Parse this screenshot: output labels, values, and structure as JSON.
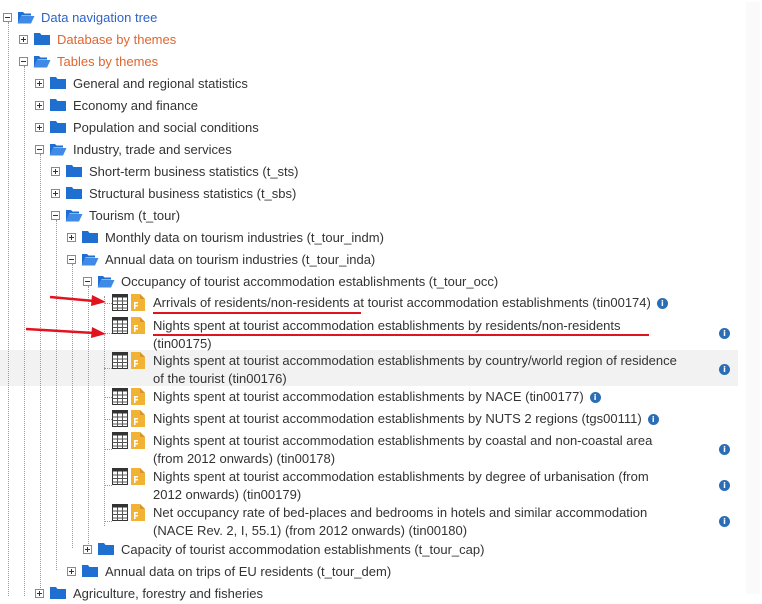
{
  "tree": {
    "root": "Data navigation tree",
    "database_by_themes": "Database by themes",
    "tables_by_themes": "Tables by themes",
    "general": "General and regional statistics",
    "economy": "Economy and finance",
    "population": "Population and social conditions",
    "industry": "Industry, trade and services",
    "short_term": "Short-term business statistics (t_sts)",
    "structural": "Structural business statistics (t_sbs)",
    "tourism": "Tourism (t_tour)",
    "monthly": "Monthly data on tourism industries (t_tour_indm)",
    "annual_industries": "Annual data on tourism industries (t_tour_inda)",
    "occupancy": "Occupancy of tourist accommodation establishments (t_tour_occ)",
    "datasets": [
      {
        "line1": "Arrivals of residents/non-residents at tourist accommodation establishments (tin00174)",
        "line2": ""
      },
      {
        "line1": "Nights spent at tourist accommodation establishments by residents/non-residents",
        "line2": "(tin00175)"
      },
      {
        "line1": "Nights spent at tourist accommodation establishments by country/world region of residence",
        "line2": "of the tourist (tin00176)"
      },
      {
        "line1": "Nights spent at tourist accommodation establishments by NACE (tin00177)",
        "line2": ""
      },
      {
        "line1": "Nights spent at tourist accommodation establishments by NUTS 2 regions (tgs00111)",
        "line2": ""
      },
      {
        "line1": "Nights spent at tourist accommodation establishments by coastal and non-coastal area",
        "line2": "(from 2012 onwards) (tin00178)"
      },
      {
        "line1": "Nights spent at tourist accommodation establishments by degree of urbanisation (from",
        "line2": "2012 onwards) (tin00179)"
      },
      {
        "line1": "Net occupancy rate of bed-places and bedrooms in hotels and similar accommodation",
        "line2": "(NACE Rev. 2, I, 55.1) (from 2012 onwards) (tin00180)"
      }
    ],
    "capacity": "Capacity of tourist accommodation establishments (t_tour_cap)",
    "annual_trips": "Annual data on trips of EU residents (t_tour_dem)",
    "agriculture": "Agriculture, forestry and fisheries"
  },
  "info_glyph": "i",
  "colors": {
    "folder": "#1f6fd1",
    "root_link": "#2e63c6",
    "orange_link": "#e0652d",
    "info": "#2c6eb5",
    "annotation": "#e0141e",
    "doc": "#f2b233"
  }
}
